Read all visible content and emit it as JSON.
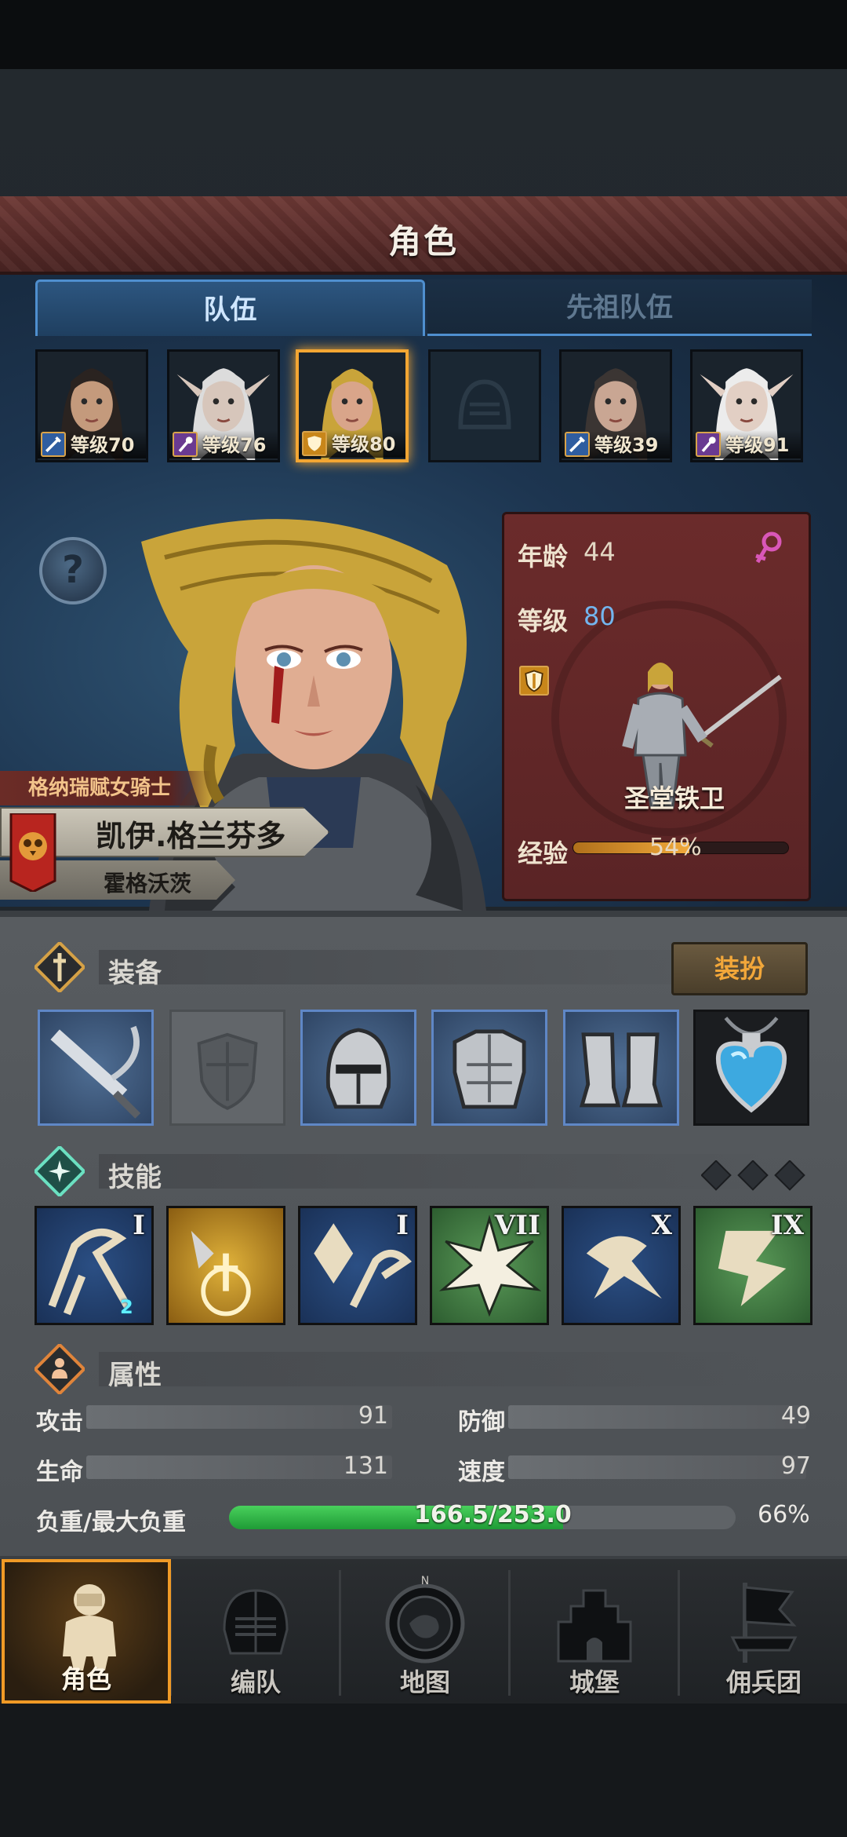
{
  "header": {
    "title": "角色"
  },
  "tabs": [
    {
      "label": "队伍",
      "active": true
    },
    {
      "label": "先祖队伍",
      "active": false
    }
  ],
  "roster": [
    {
      "class": "sword-icon",
      "level_text": "等级70",
      "hair": "#2a2320",
      "skin": "#c49a7c",
      "elf": false,
      "selected": false
    },
    {
      "class": "staff-icon",
      "level_text": "等级76",
      "hair": "#dcdcdc",
      "skin": "#d7c6bb",
      "elf": true,
      "selected": false
    },
    {
      "class": "shield-icon",
      "level_text": "等级80",
      "hair": "#c9a43a",
      "skin": "#d9a58a",
      "elf": false,
      "selected": true
    },
    {
      "class": "helmet-placeholder-icon",
      "level_text": "",
      "empty": true
    },
    {
      "class": "sword-icon",
      "level_text": "等级39",
      "hair": "#3b3533",
      "skin": "#c9a693",
      "elf": false,
      "selected": false
    },
    {
      "class": "staff-icon",
      "level_text": "等级91",
      "hair": "#ececec",
      "skin": "#e2cfc4",
      "elf": true,
      "selected": false
    }
  ],
  "help_button": {
    "label": "?"
  },
  "hero": {
    "title": "格纳瑞赋女骑士",
    "name": "凯伊.格兰芬多",
    "origin": "霍格沃茨"
  },
  "info": {
    "age_label": "年龄",
    "age_value": "44",
    "level_label": "等级",
    "level_value": "80",
    "rank": "圣堂铁卫",
    "exp_label": "经验",
    "exp_percent": 54,
    "exp_text": "54%"
  },
  "equipment": {
    "title": "装备",
    "dress_button": "装扮",
    "slots": [
      "sword-icon",
      "shield-placeholder-icon",
      "helmet-icon",
      "chest-armor-icon",
      "boots-icon",
      "amulet-icon"
    ]
  },
  "skills": {
    "title": "技能",
    "items": [
      {
        "rank": "I",
        "badge": "2",
        "color": "blue"
      },
      {
        "rank": "",
        "badge": "",
        "color": "gold"
      },
      {
        "rank": "I",
        "badge": "",
        "color": "blue"
      },
      {
        "rank": "VII",
        "badge": "",
        "color": "green"
      },
      {
        "rank": "X",
        "badge": "",
        "color": "blue"
      },
      {
        "rank": "IX",
        "badge": "",
        "color": "green"
      }
    ]
  },
  "attributes": {
    "title": "属性",
    "attack_label": "攻击",
    "attack_value": "91",
    "defense_label": "防御",
    "defense_value": "49",
    "hp_label": "生命",
    "hp_value": "131",
    "speed_label": "速度",
    "speed_value": "97",
    "load_label": "负重/最大负重",
    "load_text": "166.5/253.0",
    "load_fraction": 0.66,
    "load_pct": "66%"
  },
  "nav": [
    {
      "label": "角色",
      "icon": "knight-icon",
      "active": true
    },
    {
      "label": "编队",
      "icon": "formation-helmet-icon",
      "active": false
    },
    {
      "label": "地图",
      "icon": "compass-map-icon",
      "active": false
    },
    {
      "label": "城堡",
      "icon": "castle-icon",
      "active": false
    },
    {
      "label": "佣兵团",
      "icon": "mercenary-banner-icon",
      "active": false
    }
  ],
  "colors": {
    "accent_gold": "#f3a633",
    "tab_blue": "#4f8fcf",
    "banner_red": "#6e3a36",
    "load_green": "#2fb548"
  }
}
